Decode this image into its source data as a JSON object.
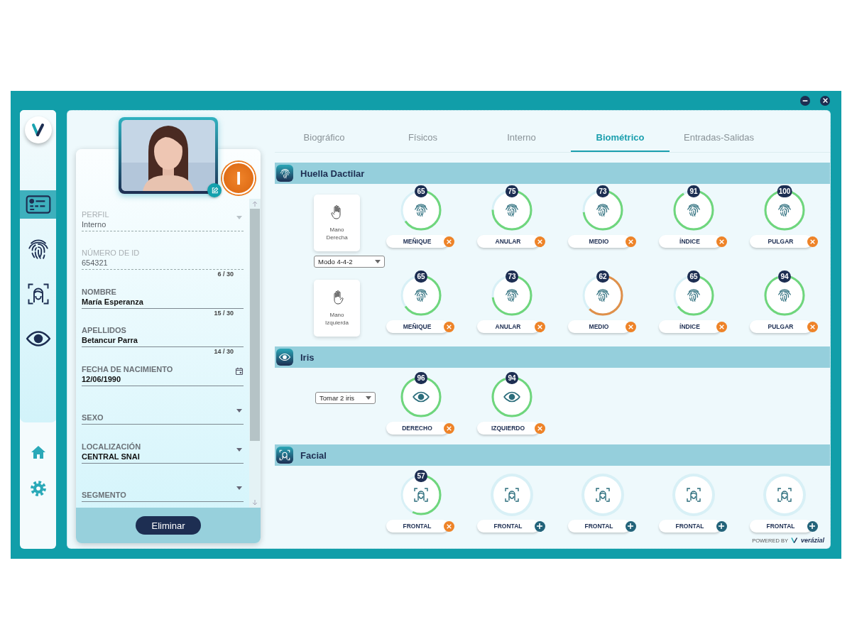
{
  "window": {
    "controls": [
      {
        "kind": "minimize"
      },
      {
        "kind": "close"
      }
    ]
  },
  "nav": {
    "items": [
      {
        "kind": "id-card",
        "selected": true
      },
      {
        "kind": "fingerprint",
        "selected": false
      },
      {
        "kind": "face",
        "selected": false
      },
      {
        "kind": "eye",
        "selected": false
      }
    ],
    "bottom": [
      {
        "kind": "home"
      },
      {
        "kind": "settings"
      }
    ]
  },
  "profile": {
    "status_badge": "I",
    "fields": [
      {
        "label": "PERFIL",
        "value": "Interno",
        "kind": "select",
        "disabled": true
      },
      {
        "label": "NÚMERO DE ID",
        "value": "654321",
        "kind": "text",
        "disabled": true,
        "counter": "6 / 30"
      },
      {
        "label": "NOMBRE",
        "value": "María Esperanza",
        "kind": "text",
        "disabled": false,
        "counter": "15 / 30"
      },
      {
        "label": "APELLIDOS",
        "value": "Betancur Parra",
        "kind": "text",
        "disabled": false,
        "counter": "14 / 30"
      },
      {
        "label": "FECHA DE NACIMIENTO",
        "value": "12/06/1990",
        "kind": "date",
        "disabled": false
      },
      {
        "label": "SEXO",
        "kind": "select",
        "disabled": false
      },
      {
        "label": "LOCALIZACIÓN",
        "value": "CENTRAL SNAI",
        "kind": "select",
        "disabled": false
      },
      {
        "label": "SEGMENTO",
        "kind": "select",
        "disabled": false
      }
    ],
    "delete_button": "Eliminar"
  },
  "tabs": [
    {
      "label": "Biográfico",
      "selected": false
    },
    {
      "label": "Físicos",
      "selected": false
    },
    {
      "label": "Interno",
      "selected": false
    },
    {
      "label": "Biométrico",
      "selected": true
    },
    {
      "label": "Entradas-Salidas",
      "selected": false
    }
  ],
  "sections": [
    {
      "kind": "fingerprint",
      "title": "Huella Dactilar",
      "mode_select": "Modo 4-4-2",
      "hands": [
        {
          "label": "Mano Derecha",
          "kind": "right",
          "captures": [
            {
              "label": "MEÑIQUE",
              "score": "65",
              "level": 0.65,
              "color": "#6fd67c",
              "kind": "remove"
            },
            {
              "label": "ANULAR",
              "score": "75",
              "level": 0.75,
              "color": "#6fd67c",
              "kind": "remove"
            },
            {
              "label": "MEDIO",
              "score": "73",
              "level": 0.73,
              "color": "#6fd67c",
              "kind": "remove"
            },
            {
              "label": "ÍNDICE",
              "score": "91",
              "level": 0.91,
              "color": "#6fd67c",
              "kind": "remove"
            },
            {
              "label": "PULGAR",
              "score": "100",
              "level": 1,
              "color": "#6fd67c",
              "kind": "remove"
            }
          ]
        },
        {
          "label": "Mano Izquierda",
          "kind": "left",
          "captures": [
            {
              "label": "MEÑIQUE",
              "score": "65",
              "level": 0.65,
              "color": "#6fd67c",
              "kind": "remove"
            },
            {
              "label": "ANULAR",
              "score": "73",
              "level": 0.73,
              "color": "#6fd67c",
              "kind": "remove"
            },
            {
              "label": "MEDIO",
              "score": "62",
              "level": 0.62,
              "color": "#e0904a",
              "kind": "remove"
            },
            {
              "label": "ÍNDICE",
              "score": "65",
              "level": 0.65,
              "color": "#6fd67c",
              "kind": "remove"
            },
            {
              "label": "PULGAR",
              "score": "94",
              "level": 0.94,
              "color": "#6fd67c",
              "kind": "remove"
            }
          ]
        }
      ]
    },
    {
      "kind": "iris",
      "title": "Iris",
      "select": "Tomar 2 iris",
      "captures": [
        {
          "label": "DERECHO",
          "score": "96",
          "level": 0.96,
          "color": "#6fd67c",
          "kind": "remove"
        },
        {
          "label": "IZQUIERDO",
          "score": "94",
          "level": 0.94,
          "color": "#6fd67c",
          "kind": "remove"
        }
      ]
    },
    {
      "kind": "face",
      "title": "Facial",
      "captures": [
        {
          "label": "FRONTAL",
          "score": "57",
          "level": 0.57,
          "color": "#6fd67c",
          "kind": "remove"
        },
        {
          "label": "FRONTAL",
          "kind": "add"
        },
        {
          "label": "FRONTAL",
          "kind": "add"
        },
        {
          "label": "FRONTAL",
          "kind": "add"
        },
        {
          "label": "FRONTAL",
          "kind": "add"
        }
      ]
    }
  ],
  "footer": {
    "powered_by": "POWERED BY",
    "brand": "verázial"
  }
}
